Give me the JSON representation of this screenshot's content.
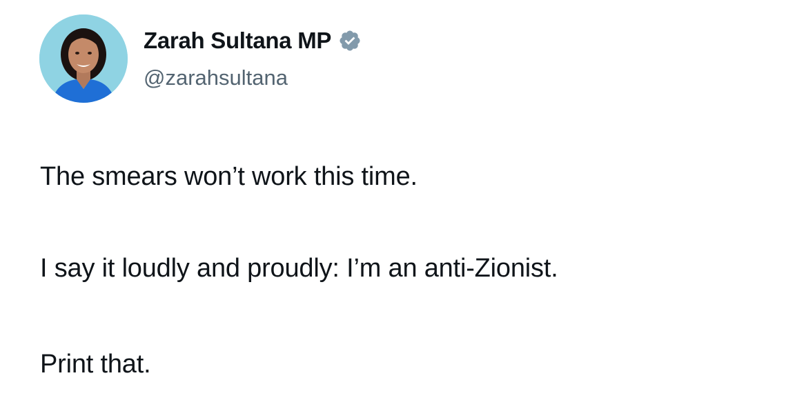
{
  "author": {
    "display_name": "Zarah Sultana MP",
    "handle": "@zarahsultana",
    "verified_color": "#829aab"
  },
  "tweet": {
    "lines": [
      "The smears won’t work this time.",
      "I say it loudly and proudly: I’m an anti-Zionist.",
      "Print that."
    ]
  },
  "colors": {
    "text": "#0f1419",
    "secondary_text": "#536471",
    "avatar_background": "#8fd3e3"
  }
}
